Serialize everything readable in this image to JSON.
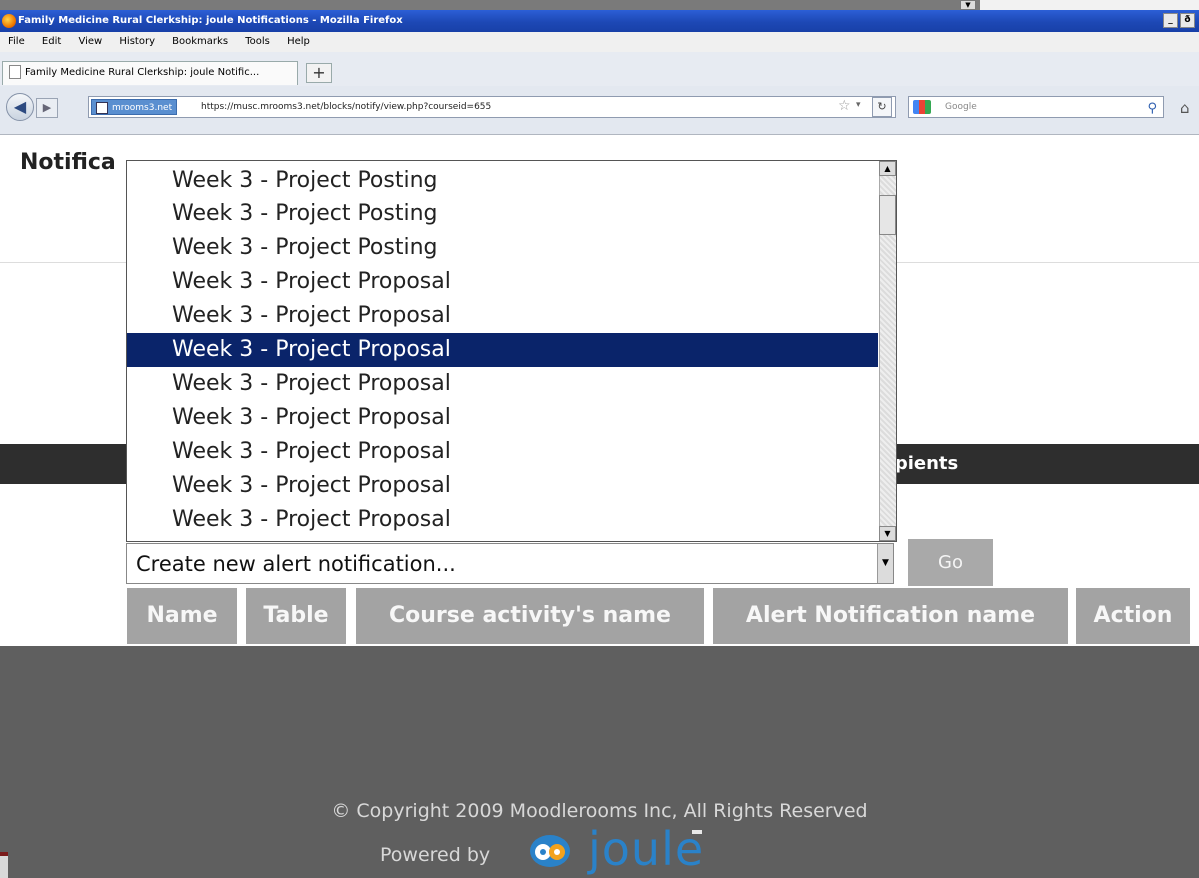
{
  "window": {
    "title": "Family Medicine Rural Clerkship: joule Notifications - Mozilla Firefox",
    "buttons": {
      "minimize": "_",
      "maximize": "ð"
    }
  },
  "menu": [
    "File",
    "Edit",
    "View",
    "History",
    "Bookmarks",
    "Tools",
    "Help"
  ],
  "tab": {
    "title": "Family Medicine Rural Clerkship: joule Notific...",
    "new_tab": "+"
  },
  "navbar": {
    "site_badge": "mrooms3.net",
    "url": "https://musc.mrooms3.net/blocks/notify/view.php?courseid=655",
    "search_placeholder": "Google"
  },
  "page": {
    "heading": "Notifica",
    "recipients_label": "cipients",
    "select_value": "Create new alert notification...",
    "go_label": "Go"
  },
  "dropdown": {
    "options": [
      "Week 3 - Project Posting",
      "Week 3 - Project Posting",
      "Week 3 - Project Posting",
      "Week 3 - Project Proposal",
      "Week 3 - Project Proposal",
      "Week 3 - Project Proposal",
      "Week 3 - Project Proposal",
      "Week 3 - Project Proposal",
      "Week 3 - Project Proposal",
      "Week 3 - Project Proposal",
      "Week 3 - Project Proposal"
    ],
    "selected_index": 5
  },
  "table": {
    "headers": [
      "Name",
      "Table",
      "Course activity's name",
      "Alert Notification name",
      "Action"
    ]
  },
  "footer": {
    "copyright": "© Copyright 2009 Moodlerooms Inc, All Rights Reserved",
    "powered_by": "Powered by",
    "logo_text": "joule"
  },
  "colors": {
    "selection": "#0a246a",
    "header_gray": "#a3a3a3",
    "footer_gray": "#5f5f5f",
    "joule_blue": "#2a82c9"
  }
}
